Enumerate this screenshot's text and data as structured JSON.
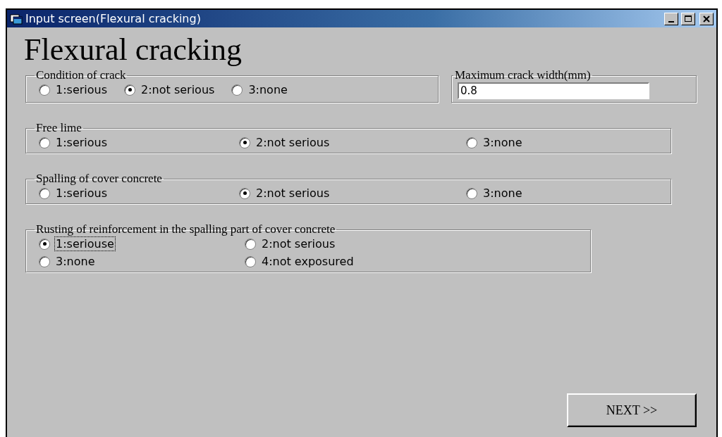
{
  "window": {
    "title": "Input screen(Flexural cracking)"
  },
  "heading": "Flexural cracking",
  "groups": [
    {
      "legend": "Condition of crack",
      "kind": "inline",
      "options": [
        {
          "label": "1:serious",
          "selected": false,
          "focused": false
        },
        {
          "label": "2:not serious",
          "selected": true,
          "focused": false
        },
        {
          "label": "3:none",
          "selected": false,
          "focused": false
        }
      ]
    },
    {
      "legend": "Free lime",
      "kind": "columns",
      "options": [
        {
          "label": "1:serious",
          "selected": false,
          "focused": false
        },
        {
          "label": "2:not serious",
          "selected": true,
          "focused": false
        },
        {
          "label": "3:none",
          "selected": false,
          "focused": false
        }
      ]
    },
    {
      "legend": "Spalling of cover concrete",
      "kind": "columns",
      "options": [
        {
          "label": "1:serious",
          "selected": false,
          "focused": false
        },
        {
          "label": "2:not serious",
          "selected": true,
          "focused": false
        },
        {
          "label": "3:none",
          "selected": false,
          "focused": false
        }
      ]
    },
    {
      "legend": "Rusting of reinforcement in the spalling part of cover concrete",
      "kind": "grid",
      "options": [
        {
          "label": "1:seriouse",
          "selected": true,
          "focused": true
        },
        {
          "label": "2:not serious",
          "selected": false,
          "focused": false
        },
        {
          "label": "3:none",
          "selected": false,
          "focused": false
        },
        {
          "label": "4:not exposured",
          "selected": false,
          "focused": false
        }
      ]
    }
  ],
  "width_field": {
    "legend": "Maximum crack width(mm)",
    "value": "0.8"
  },
  "next_button": "NEXT >>"
}
